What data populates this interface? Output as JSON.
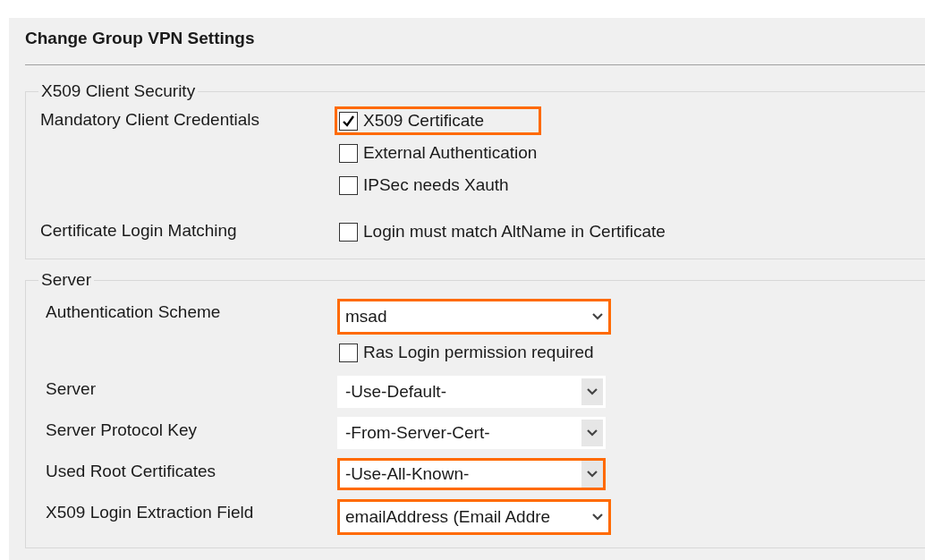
{
  "dialog": {
    "title": "Change Group VPN Settings"
  },
  "sections": [
    {
      "legend": "X509 Client Security",
      "rows": [
        {
          "label": "Mandatory Client Credentials",
          "controls": [
            {
              "kind": "checkbox",
              "label": "X509 Certificate",
              "checked": true,
              "highlighted": true
            },
            {
              "kind": "checkbox",
              "label": "External Authentication",
              "checked": false,
              "highlighted": false
            },
            {
              "kind": "checkbox",
              "label": "IPSec needs Xauth",
              "checked": false,
              "highlighted": false
            }
          ]
        },
        {
          "label": "Certificate Login Matching",
          "controls": [
            {
              "kind": "checkbox",
              "label": "Login must match AltName in Certificate",
              "checked": false,
              "highlighted": false
            }
          ]
        }
      ]
    },
    {
      "legend": "Server",
      "rows": [
        {
          "label": "Authentication Scheme",
          "controls": [
            {
              "kind": "combo",
              "value": "msad",
              "highlighted": true
            },
            {
              "kind": "checkbox",
              "label": "Ras Login permission required",
              "checked": false,
              "highlighted": false
            }
          ]
        },
        {
          "label": "Server",
          "controls": [
            {
              "kind": "list",
              "value": "-Use-Default-",
              "highlighted": false
            }
          ]
        },
        {
          "label": "Server Protocol Key",
          "controls": [
            {
              "kind": "list",
              "value": "-From-Server-Cert-",
              "highlighted": false
            }
          ]
        },
        {
          "label": "Used Root Certificates",
          "controls": [
            {
              "kind": "list",
              "value": "-Use-All-Known-",
              "highlighted": true
            }
          ]
        },
        {
          "label": "X509 Login Extraction Field",
          "controls": [
            {
              "kind": "combo",
              "value": "emailAddress (Email Addre",
              "highlighted": true
            }
          ]
        }
      ]
    }
  ]
}
